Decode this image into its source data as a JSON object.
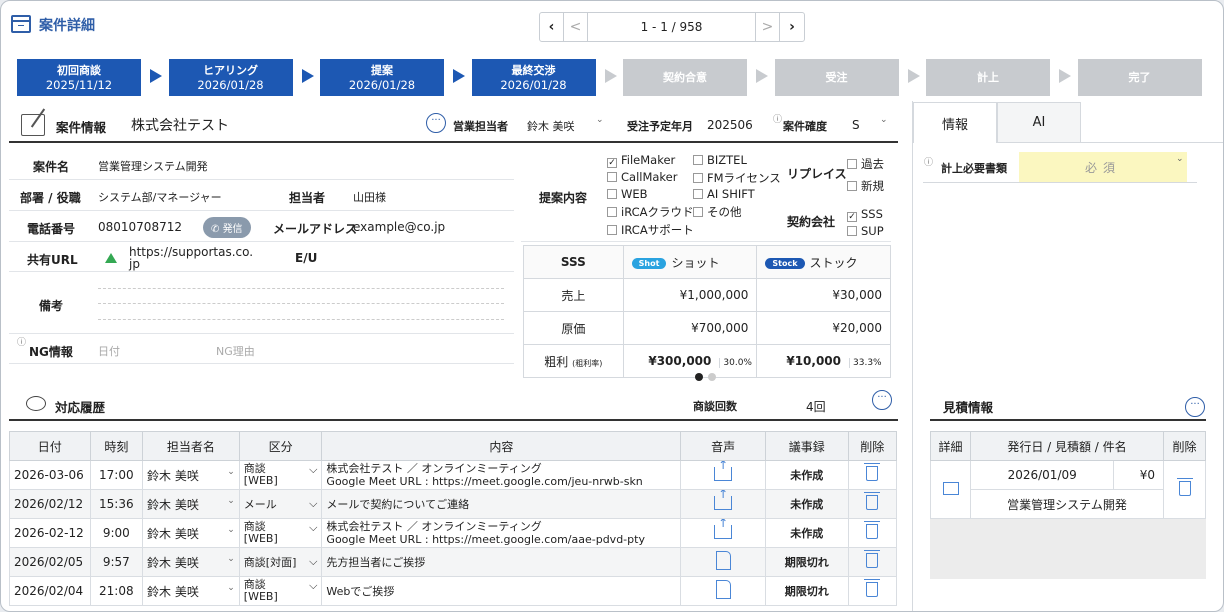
{
  "header": {
    "title": "案件詳細",
    "pager": {
      "first": "‹",
      "prev": "<",
      "info": "1 - 1 / 958",
      "next": ">",
      "last": "›"
    }
  },
  "steps": [
    {
      "name": "初回商談",
      "date": "2025/11/12",
      "active": true
    },
    {
      "name": "ヒアリング",
      "date": "2026/01/28",
      "active": true
    },
    {
      "name": "提案",
      "date": "2026/01/28",
      "active": true
    },
    {
      "name": "最終交渉",
      "date": "2026/01/28",
      "active": true
    },
    {
      "name": "契約合意",
      "date": "",
      "active": false
    },
    {
      "name": "受注",
      "date": "",
      "active": false
    },
    {
      "name": "計上",
      "date": "",
      "active": false
    },
    {
      "name": "完了",
      "date": "",
      "active": false
    }
  ],
  "case": {
    "section_title": "案件情報",
    "company": "株式会社テスト",
    "sales_rep_label": "営業担当者",
    "sales_rep": "鈴木 美咲",
    "order_month_label": "受注予定年月",
    "order_month": "202506",
    "certainty_label": "案件確度",
    "certainty": "S",
    "name_label": "案件名",
    "name": "営業管理システム開発",
    "dept_label": "部署 / 役職",
    "dept": "システム部/マネージャー",
    "contact_label": "担当者",
    "contact": "山田様",
    "phone_label": "電話番号",
    "phone": "08010708712",
    "call_label": "発信",
    "email_label": "メールアドレス",
    "email": "example@co.jp",
    "url_label": "共有URL",
    "url": "https://supportas.co.jp",
    "eu_label": "E/U",
    "memo_label": "備考",
    "ng_label": "NG情報",
    "ng_date_ph": "日付",
    "ng_reason_ph": "NG理由"
  },
  "proposal": {
    "label": "提案内容",
    "items": [
      {
        "text": "FileMaker",
        "checked": true
      },
      {
        "text": "CallMaker",
        "checked": false
      },
      {
        "text": "WEB",
        "checked": false
      },
      {
        "text": "iRCAクラウド",
        "checked": false
      },
      {
        "text": "IRCAサポート",
        "checked": false
      },
      {
        "text": "BIZTEL",
        "checked": false
      },
      {
        "text": "FMライセンス",
        "checked": false
      },
      {
        "text": "AI SHIFT",
        "checked": false
      },
      {
        "text": "その他",
        "checked": false
      }
    ],
    "replace_label": "リプレイス",
    "replace": [
      {
        "text": "過去",
        "checked": false
      },
      {
        "text": "新規",
        "checked": false
      }
    ],
    "contract_label": "契約会社",
    "contract": [
      {
        "text": "SSS",
        "checked": true
      },
      {
        "text": "SUP",
        "checked": false
      }
    ]
  },
  "sss_table": {
    "head": "SSS",
    "shot_badge": "Shot",
    "shot": "ショット",
    "stock_badge": "Stock",
    "stock": "ストック",
    "rows": [
      {
        "label": "売上",
        "shot": "¥1,000,000",
        "stock": "¥30,000"
      },
      {
        "label": "原価",
        "shot": "¥700,000",
        "stock": "¥20,000"
      }
    ],
    "profit_label": "粗利",
    "profit_sub": "(粗利率)",
    "profit_shot": "¥300,000",
    "profit_shot_rate": "30.0%",
    "profit_stock": "¥10,000",
    "profit_stock_rate": "33.3%"
  },
  "history": {
    "title": "対応履歴",
    "count_label": "商談回数",
    "count": "4回",
    "columns": [
      "日付",
      "時刻",
      "担当者名",
      "区分",
      "内容",
      "音声",
      "議事録",
      "削除"
    ],
    "rows": [
      {
        "date": "2026-03-06",
        "time": "17:00",
        "rep": "鈴木 美咲",
        "cat": "商談 [WEB]",
        "c1": "株式会社テスト ／ オンラインミーティング",
        "c2": "Google Meet URL : https://meet.google.com/jeu-nrwb-skn",
        "audio": "upload",
        "minutes": "未作成"
      },
      {
        "date": "2026/02/12",
        "time": "15:36",
        "rep": "鈴木 美咲",
        "cat": "メール",
        "c1": "メールで契約についてご連絡",
        "c2": "",
        "audio": "upload",
        "minutes": "未作成"
      },
      {
        "date": "2026-02-12",
        "time": "9:00",
        "rep": "鈴木 美咲",
        "cat": "商談 [WEB]",
        "c1": "株式会社テスト ／ オンラインミーティング",
        "c2": "Google Meet URL : https://meet.google.com/aae-pdvd-pty",
        "audio": "upload",
        "minutes": "未作成"
      },
      {
        "date": "2026/02/05",
        "time": "9:57",
        "rep": "鈴木 美咲",
        "cat": "商談[対面]",
        "c1": "先方担当者にご挨拶",
        "c2": "",
        "audio": "doc",
        "minutes": "期限切れ"
      },
      {
        "date": "2026/02/04",
        "time": "21:08",
        "rep": "鈴木 美咲",
        "cat": "商談 [WEB]",
        "c1": "Webでご挨拶",
        "c2": "",
        "audio": "doc",
        "minutes": "期限切れ"
      }
    ]
  },
  "right_panel": {
    "tabs": [
      "情報",
      "AI"
    ],
    "docs_label": "計上必要書類",
    "docs_value": "必須",
    "quote_title": "見積情報",
    "quote_columns": [
      "詳細",
      "発行日 / 見積額 / 件名",
      "削除"
    ],
    "quote_row": {
      "date": "2026/01/09",
      "amount": "¥0",
      "subject": "営業管理システム開発"
    }
  }
}
